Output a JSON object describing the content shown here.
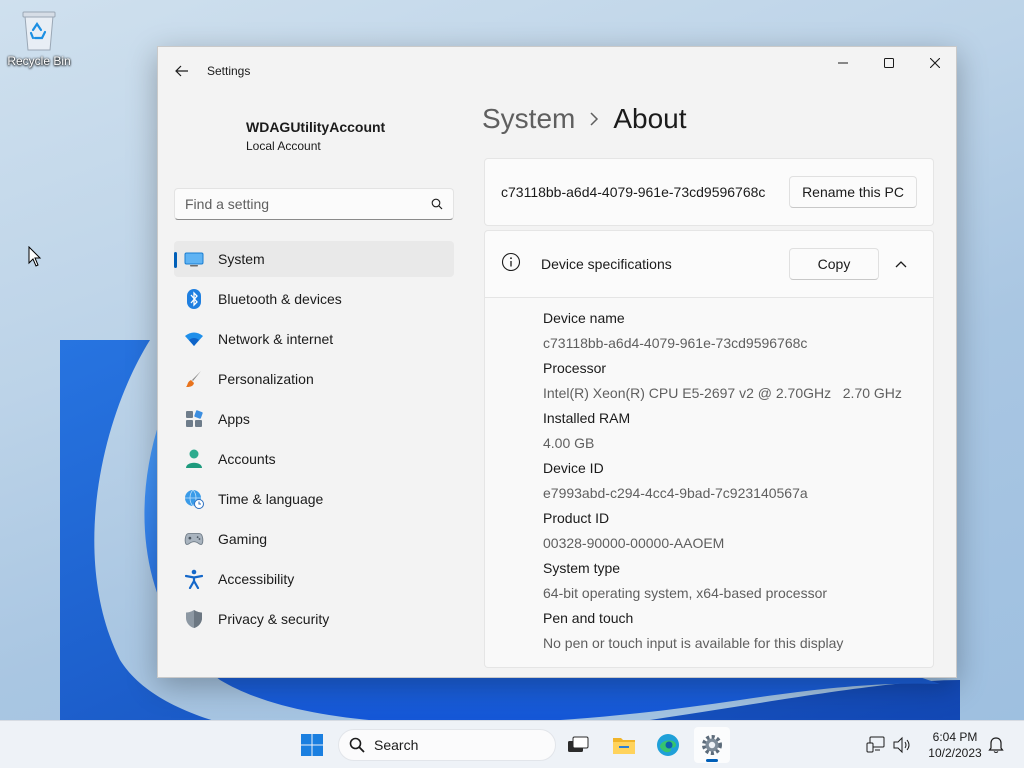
{
  "desktop": {
    "recycle_bin_label": "Recycle Bin"
  },
  "window": {
    "app_title": "Settings",
    "profile": {
      "name": "WDAGUtilityAccount",
      "account_type": "Local Account"
    },
    "search": {
      "placeholder": "Find a setting"
    },
    "nav_items": [
      {
        "label": "System",
        "icon": "system-icon",
        "active": true
      },
      {
        "label": "Bluetooth & devices",
        "icon": "bluetooth-icon"
      },
      {
        "label": "Network & internet",
        "icon": "wifi-icon"
      },
      {
        "label": "Personalization",
        "icon": "brush-icon"
      },
      {
        "label": "Apps",
        "icon": "apps-icon"
      },
      {
        "label": "Accounts",
        "icon": "person-icon"
      },
      {
        "label": "Time & language",
        "icon": "globe-clock-icon"
      },
      {
        "label": "Gaming",
        "icon": "gamepad-icon"
      },
      {
        "label": "Accessibility",
        "icon": "accessibility-icon"
      },
      {
        "label": "Privacy & security",
        "icon": "shield-icon"
      }
    ],
    "breadcrumb": {
      "parent": "System",
      "current": "About"
    },
    "pc_card": {
      "pc_name": "c73118bb-a6d4-4079-961e-73cd9596768c",
      "rename_label": "Rename this PC"
    },
    "device_specs": {
      "title": "Device specifications",
      "copy_label": "Copy",
      "rows": [
        {
          "key": "Device name",
          "value": "c73118bb-a6d4-4079-961e-73cd9596768c"
        },
        {
          "key": "Processor",
          "value": "Intel(R) Xeon(R) CPU E5-2697 v2 @ 2.70GHz   2.70 GHz"
        },
        {
          "key": "Installed RAM",
          "value": "4.00 GB"
        },
        {
          "key": "Device ID",
          "value": "e7993abd-c294-4cc4-9bad-7c923140567a"
        },
        {
          "key": "Product ID",
          "value": "00328-90000-00000-AAOEM"
        },
        {
          "key": "System type",
          "value": "64-bit operating system, x64-based processor"
        },
        {
          "key": "Pen and touch",
          "value": "No pen or touch input is available for this display"
        }
      ]
    }
  },
  "taskbar": {
    "search_label": "Search",
    "time": "6:04 PM",
    "date": "10/2/2023"
  },
  "colors": {
    "accent": "#005fb8",
    "window_bg": "#f3f3f3",
    "card_bg": "#fbfbfb"
  }
}
